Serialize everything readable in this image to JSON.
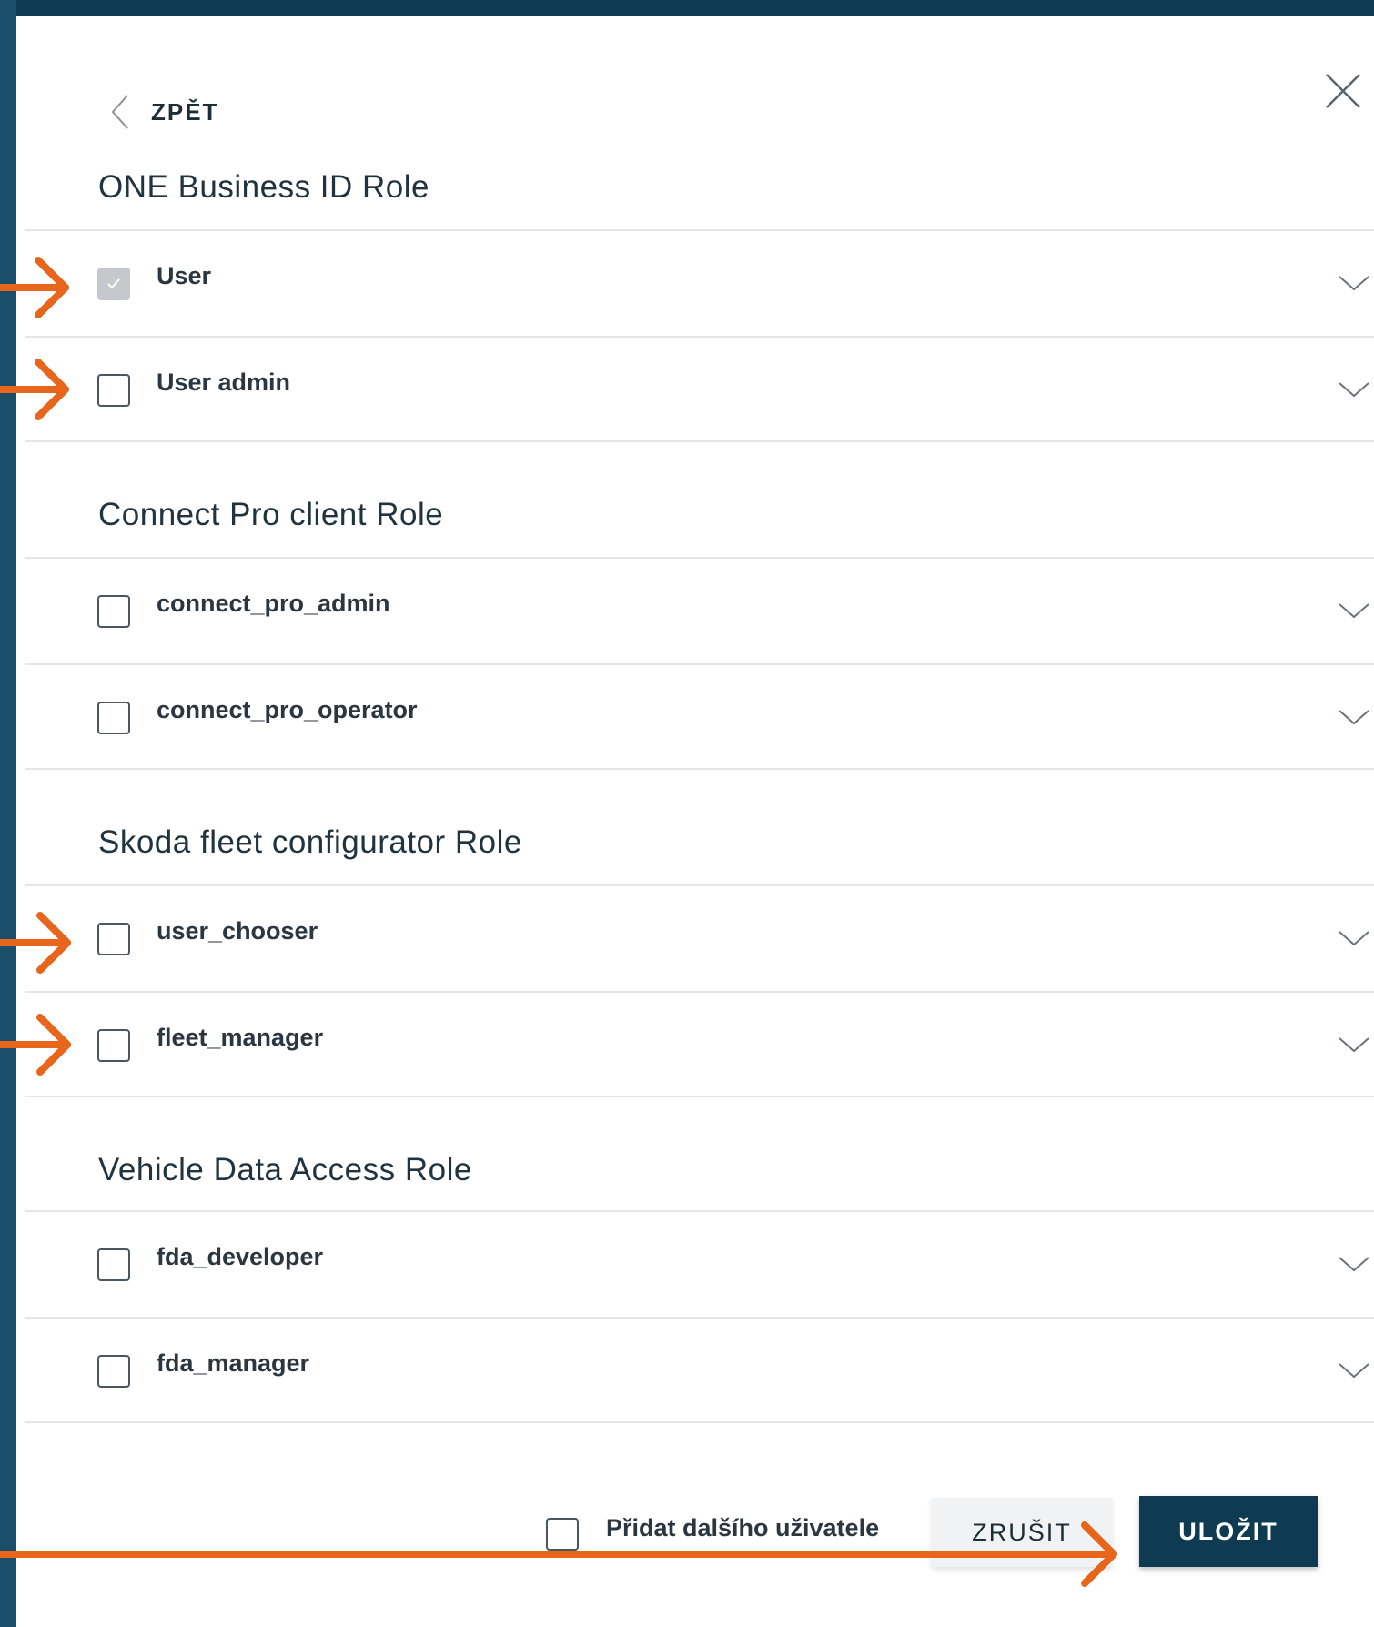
{
  "nav": {
    "back_label": "ZPĚT"
  },
  "sections": [
    {
      "title": "ONE Business ID Role",
      "roles": [
        {
          "label": "User",
          "checked": true,
          "disabled": true
        },
        {
          "label": "User admin",
          "checked": false
        }
      ]
    },
    {
      "title": "Connect Pro client Role",
      "roles": [
        {
          "label": "connect_pro_admin",
          "checked": false
        },
        {
          "label": "connect_pro_operator",
          "checked": false
        }
      ]
    },
    {
      "title": "Skoda fleet configurator Role",
      "roles": [
        {
          "label": "user_chooser",
          "checked": false
        },
        {
          "label": "fleet_manager",
          "checked": false
        }
      ]
    },
    {
      "title": "Vehicle Data Access Role",
      "roles": [
        {
          "label": "fda_developer",
          "checked": false
        },
        {
          "label": "fda_manager",
          "checked": false
        }
      ]
    }
  ],
  "footer": {
    "add_another_label": "Přidat dalšího uživatele",
    "add_another_checked": false,
    "cancel_label": "ZRUŠIT",
    "save_label": "ULOŽIT"
  },
  "colors": {
    "primary": "#0e3a52",
    "annotation_arrow": "#e8661b",
    "checkbox_disabled": "#c5c8cc"
  }
}
